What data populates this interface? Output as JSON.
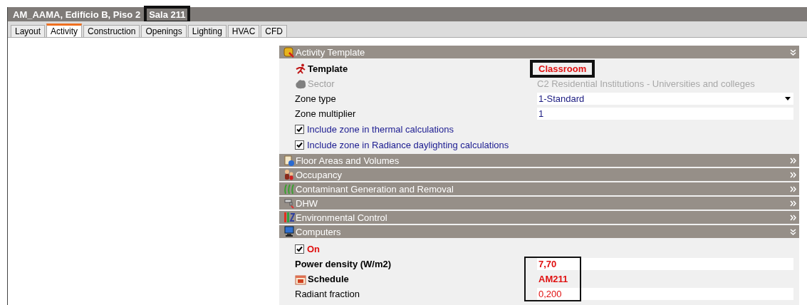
{
  "window": {
    "title_parts": [
      {
        "text": "AM_AAMA, Edifício B, Piso 2",
        "highlighted": false
      },
      {
        "text": "Sala 211",
        "highlighted": true
      }
    ]
  },
  "tabs": [
    {
      "label": "Layout",
      "selected": false
    },
    {
      "label": "Activity",
      "selected": true
    },
    {
      "label": "Construction",
      "selected": false
    },
    {
      "label": "Openings",
      "selected": false
    },
    {
      "label": "Lighting",
      "selected": false
    },
    {
      "label": "HVAC",
      "selected": false
    },
    {
      "label": "CFD",
      "selected": false
    }
  ],
  "sections": [
    {
      "title": "Activity Template",
      "expanded": true,
      "rows": [
        {
          "kind": "heading",
          "label": "Template",
          "value": "Classroom",
          "highlighted": true
        },
        {
          "kind": "disabled",
          "label": "Sector",
          "value": "C2 Residential Institutions - Universities and colleges",
          "highlighted": false
        },
        {
          "kind": "dropdown",
          "label": "Zone type",
          "value": "1-Standard",
          "highlighted": false
        },
        {
          "kind": "field",
          "label": "Zone multiplier",
          "value": "1",
          "highlighted": false
        },
        {
          "kind": "checkbox",
          "label": "Include zone in thermal calculations",
          "checked": true
        },
        {
          "kind": "checkbox",
          "label": "Include zone in Radiance daylighting calculations",
          "checked": true
        }
      ]
    },
    {
      "title": "Floor Areas and Volumes",
      "expanded": false
    },
    {
      "title": "Occupancy",
      "expanded": false
    },
    {
      "title": "Contaminant Generation and Removal",
      "expanded": false
    },
    {
      "title": "DHW",
      "expanded": false
    },
    {
      "title": "Environmental Control",
      "expanded": false
    },
    {
      "title": "Computers",
      "expanded": true,
      "rows": [
        {
          "kind": "switch",
          "label": "On",
          "checked": true
        },
        {
          "kind": "override-field",
          "bold": true,
          "label": "Power density (W/m2)",
          "value": "7,70",
          "highlighted": true
        },
        {
          "kind": "heading",
          "label": "Schedule",
          "value": "AM211",
          "highlighted": true
        },
        {
          "kind": "override-field",
          "bold": false,
          "label": "Radiant fraction",
          "value": "0,200",
          "highlighted": true
        }
      ]
    }
  ]
}
